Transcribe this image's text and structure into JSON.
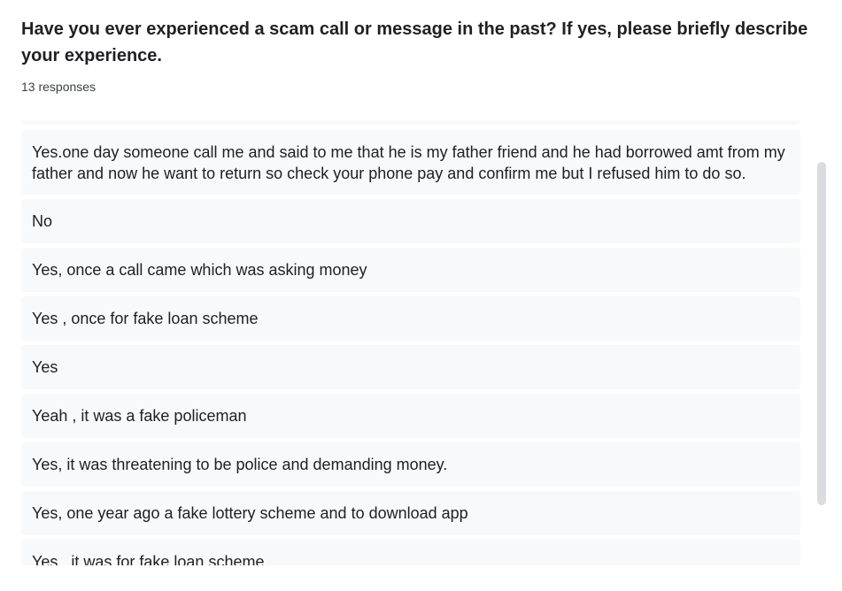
{
  "question": {
    "title": "Have you ever experienced a scam call or message in the past? If yes, please briefly describe your experience.",
    "response_count": "13 responses"
  },
  "responses": [
    "Yes.one day someone call me and said to me that he is my father friend and he had borrowed amt from my father and now he want to return so check your phone pay and confirm me but I refused him to do so.",
    "No",
    "Yes, once a call came which was asking money",
    "Yes , once for fake loan scheme",
    "Yes",
    "Yeah , it was a fake policeman",
    "Yes, it was threatening to be police and demanding money.",
    "Yes, one year ago a fake lottery scheme and to download app",
    "Yes , it was for fake loan scheme"
  ],
  "scrollbar": {
    "position": "middle"
  }
}
